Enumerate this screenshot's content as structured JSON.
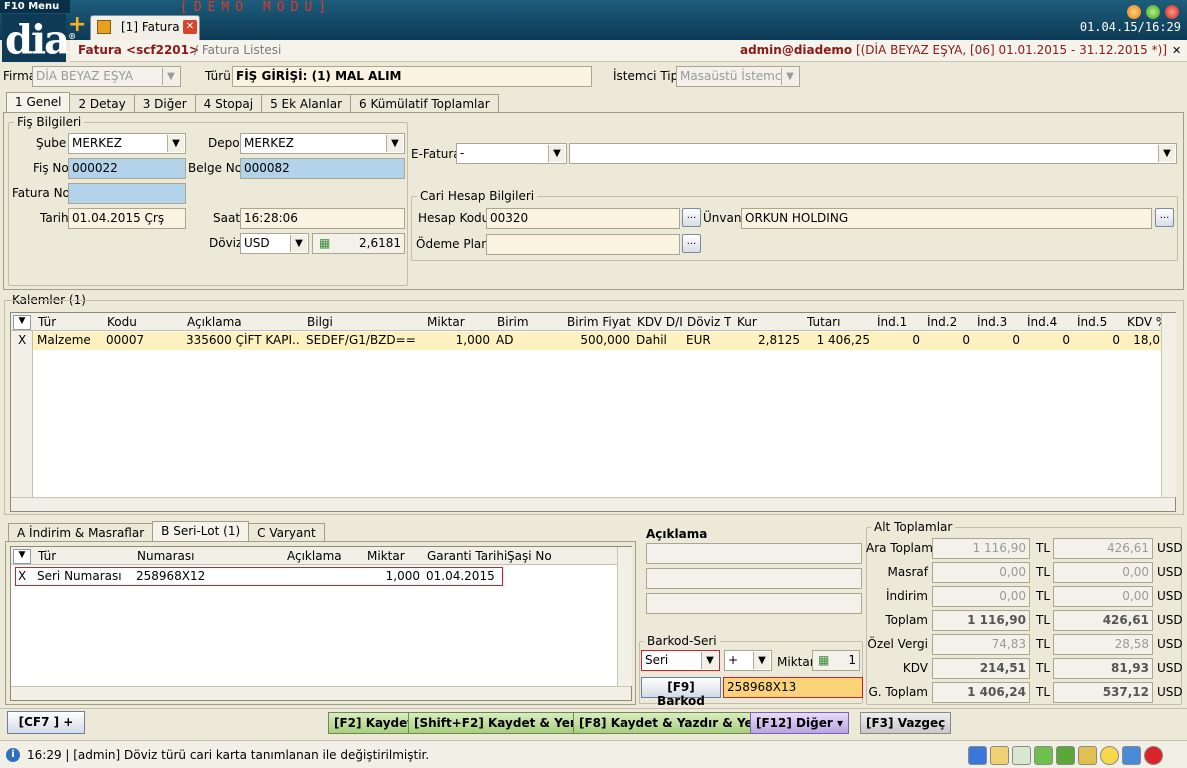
{
  "app": {
    "menu": "F10 Menu",
    "logo": "dia",
    "logo_mark": "®",
    "demo": "[DEMO MODU]",
    "tab": "[1] Fatura",
    "clock": "01.04.15/16:29"
  },
  "subheader": {
    "title": "Fatura <scf2201>",
    "breadcrumb": "/ Fatura Listesi",
    "user": "admin@diademo",
    "period": "[(DİA BEYAZ EŞYA, [06] 01.01.2015 - 31.12.2015 *)]"
  },
  "top": {
    "firma_label": "Firma",
    "firma_value": "DİA BEYAZ EŞYA",
    "turu_label": "Türü",
    "turu_value": "FİŞ GİRİŞİ: (1) MAL ALIM",
    "istemci_label": "İstemci Tipi",
    "istemci_value": "Masaüstü İstemci"
  },
  "tabs": [
    "1 Genel",
    "2 Detay",
    "3 Diğer",
    "4 Stopaj",
    "5 Ek Alanlar",
    "6 Kümülatif Toplamlar"
  ],
  "fis": {
    "group": "Fiş Bilgileri",
    "sube_label": "Şube",
    "sube": "MERKEZ",
    "depo_label": "Depo",
    "depo": "MERKEZ",
    "fisno_label": "Fiş No",
    "fisno": "000022",
    "belgeno_label": "Belge No",
    "belgeno": "000082",
    "faturano_label": "Fatura No",
    "faturano": "",
    "tarih_label": "Tarih",
    "tarih": "01.04.2015 Çrş",
    "saat_label": "Saat",
    "saat": "16:28:06",
    "doviz_label": "Döviz",
    "doviz": "USD",
    "kur": "2,6181"
  },
  "efatura": {
    "label": "E-Fatura",
    "value": "-",
    "value2": ""
  },
  "cari": {
    "group": "Cari Hesap Bilgileri",
    "hesap_label": "Hesap Kodu",
    "hesap": "00320",
    "unvan_label": "Ünvanı",
    "unvan": "ORKUN HOLDING",
    "odeme_label": "Ödeme Planı",
    "odeme": "",
    "dots": "..."
  },
  "kalemler": {
    "title": "Kalemler (1)",
    "headers": [
      "Tür",
      "Kodu",
      "Açıklama",
      "Bilgi",
      "Miktar",
      "Birim",
      "Birim Fiyat",
      "KDV D/I",
      "Döviz Tı",
      "Kur",
      "Tutarı",
      "İnd.1",
      "İnd.2",
      "İnd.3",
      "İnd.4",
      "İnd.5",
      "KDV %"
    ],
    "rows": [
      {
        "mark": "X",
        "cells": [
          "Malzeme",
          "00007",
          "335600 ÇİFT KAPI...",
          "SEDEF/G1/BZD==",
          "1,000",
          "AD",
          "500,000",
          "Dahil",
          "EUR",
          "2,8125",
          "1 406,25",
          "0",
          "0",
          "0",
          "0",
          "0",
          "18,0"
        ]
      }
    ]
  },
  "bottom_tabs": [
    "A İndirim & Masraflar",
    "B Seri-Lot (1)",
    "C Varyant"
  ],
  "serilot": {
    "headers": [
      "Tür",
      "Numarası",
      "Açıklama",
      "Miktar",
      "Garanti Tarihi",
      "Şaşi No"
    ],
    "rows": [
      {
        "mark": "X",
        "cells": [
          "Seri Numarası",
          "258968X12",
          "",
          "1,000",
          "01.04.2015",
          ""
        ]
      }
    ]
  },
  "aciklama": {
    "title": "Açıklama"
  },
  "barkod": {
    "group": "Barkod-Seri",
    "type": "Seri",
    "sign": "+",
    "miktar_label": "Miktar",
    "miktar": "1",
    "button": "[F9] Barkod",
    "value": "258968X13"
  },
  "totals": {
    "group": "Alt Toplamlar",
    "rows": [
      {
        "label": "Ara Toplam",
        "tl": "1 116,90",
        "usd": "426,61"
      },
      {
        "label": "Masraf",
        "tl": "0,00",
        "usd": "0,00"
      },
      {
        "label": "İndirim",
        "tl": "0,00",
        "usd": "0,00"
      },
      {
        "label": "Toplam",
        "tl": "1 116,90",
        "usd": "426,61"
      },
      {
        "label": "Özel Vergi",
        "tl": "74,83",
        "usd": "28,58"
      },
      {
        "label": "KDV",
        "tl": "214,51",
        "usd": "81,93"
      },
      {
        "label": "G. Toplam",
        "tl": "1 406,24",
        "usd": "537,12"
      }
    ],
    "cur1": "TL",
    "cur2": "USD"
  },
  "actions": {
    "cf7": "[CF7 ] +",
    "f2": "[F2] Kaydet",
    "shiftf2": "[Shift+F2] Kaydet & Yeni",
    "f8": "[F8] Kaydet & Yazdır & Yeni",
    "f12": "[F12] Diğer",
    "f3": "[F3] Vazgeç"
  },
  "status": {
    "text": "16:29 | [admin] Döviz türü cari karta tanımlanan ile değiştirilmiştir."
  }
}
